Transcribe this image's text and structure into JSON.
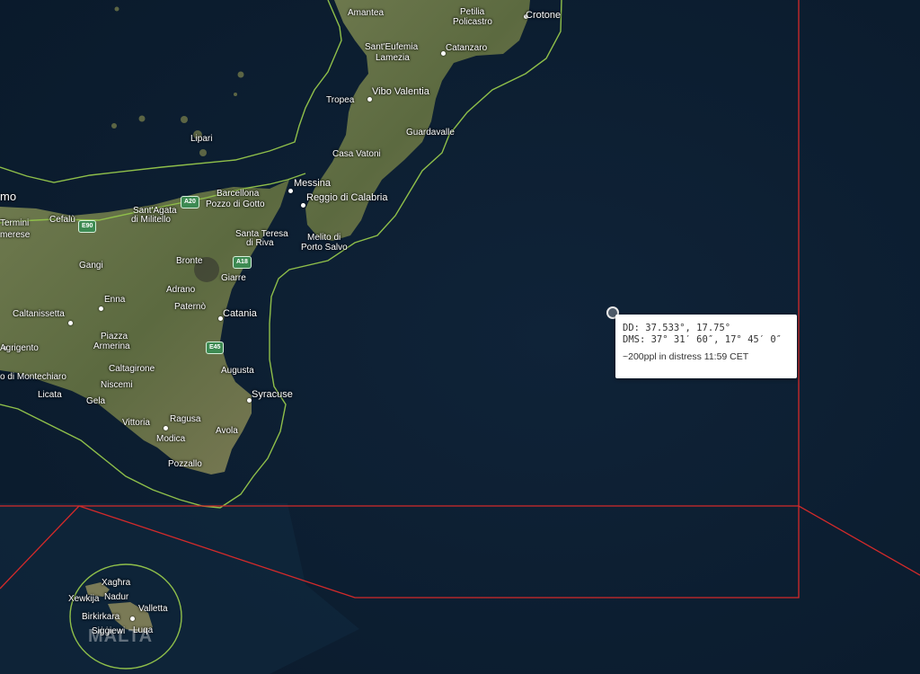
{
  "map": {
    "basemap": "satellite",
    "colors": {
      "sea": "#0d1f33",
      "land": "#5e6a45",
      "zone_line": "#8fbf4a",
      "sar_line": "#d42a2a"
    },
    "labels": {
      "amantea": "Amantea",
      "petilia_1": "Petilia",
      "petilia_2": "Policastro",
      "crotone": "Crotone",
      "santeufemia_1": "Sant'Eufemia",
      "santeufemia_2": "Lamezia",
      "catanzaro": "Catanzaro",
      "tropea": "Tropea",
      "vibo": "Vibo Valentia",
      "guardavalle": "Guardavalle",
      "lipari": "Lipari",
      "casa_vatoni": "Casa Vatoni",
      "messina": "Messina",
      "reggio": "Reggio di Calabria",
      "barcellona_1": "Barcellona",
      "barcellona_2": "Pozzo di Gotto",
      "santagata_1": "Sant'Agata",
      "santagata_2": "di Militello",
      "cefalu": "Cefalù",
      "termini_1": "Termini",
      "termini_2": "merese",
      "palermo_partial": "mo",
      "melito_1": "Melito di",
      "melito_2": "Porto Salvo",
      "santa_teresa_1": "Santa Teresa",
      "santa_teresa_2": "di Riva",
      "gangi": "Gangi",
      "bronte": "Bronte",
      "giarre": "Giarre",
      "enna": "Enna",
      "adrano": "Adrano",
      "paterno": "Paternò",
      "caltanissetta": "Caltanissetta",
      "catania": "Catania",
      "agrigento": "Agrigento",
      "piazza_1": "Piazza",
      "piazza_2": "Armerina",
      "caltagirone": "Caltagirone",
      "augusta": "Augusta",
      "montechiaro": "o di Montechiaro",
      "niscemi": "Niscemi",
      "syracuse": "Syracuse",
      "licata": "Licata",
      "gela": "Gela",
      "vittoria": "Vittoria",
      "ragusa": "Ragusa",
      "avola": "Avola",
      "modica": "Modica",
      "pozzallo": "Pozzallo",
      "xaghra": "Xagħra",
      "xewkija": "Xewkija",
      "nadur": "Nadur",
      "valletta": "Valletta",
      "birkirkara": "Birkirkara",
      "siggiewi": "Siġġiewi",
      "luqa": "Luqa",
      "malta": "MALTA"
    },
    "roads": {
      "a20": "A20",
      "e90": "E90",
      "a18": "A18",
      "e45": "E45"
    }
  },
  "marker": {
    "popup": {
      "dd_line": "DD: 37.533°, 17.75°",
      "dms_line": "DMS: 37° 31′ 60″, 17° 45′ 0″",
      "note": "~200ppl in distress 11:59 CET"
    }
  }
}
